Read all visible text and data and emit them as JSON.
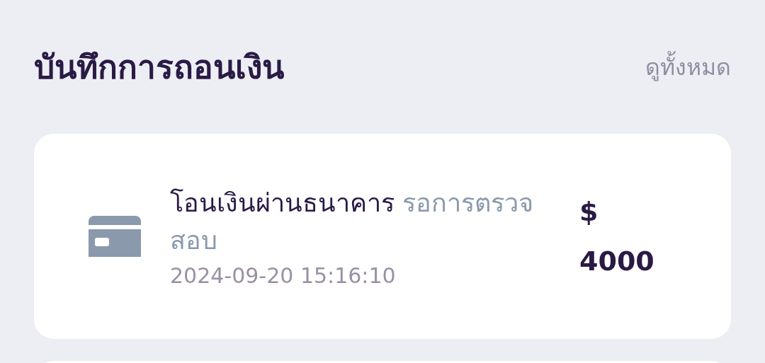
{
  "header": {
    "title": "บันทึกการถอนเงิน",
    "view_all": "ดูทั้งหมด"
  },
  "records": [
    {
      "method": "โอนเงินผ่านธนาคาร",
      "status": "รอการตรวจสอบ",
      "datetime": "2024-09-20 15:16:10",
      "currency": "$",
      "amount": "4000"
    }
  ],
  "more_records_below": true
}
